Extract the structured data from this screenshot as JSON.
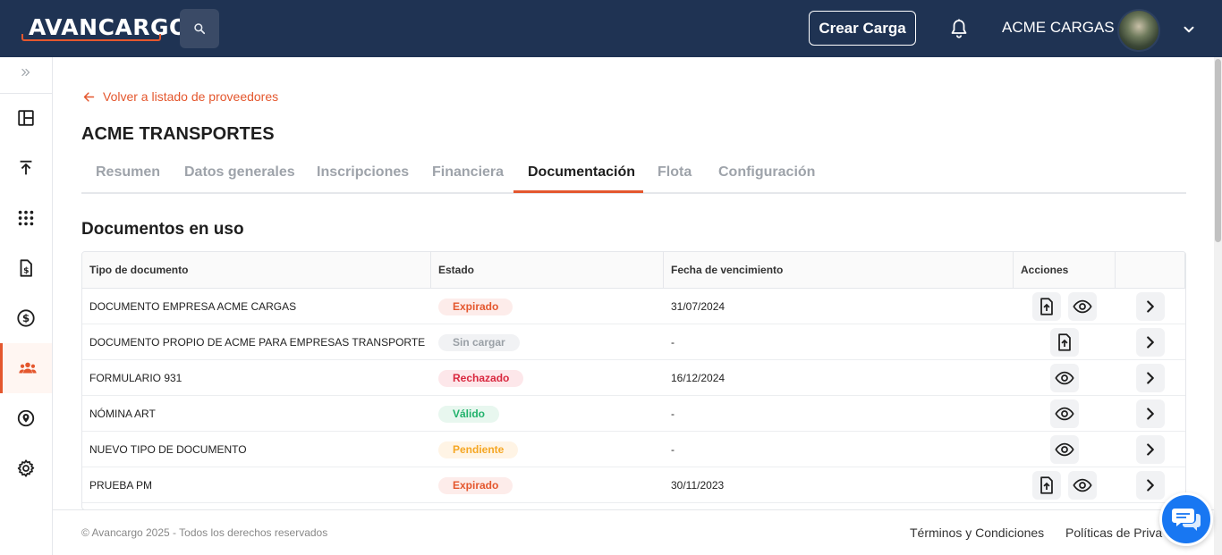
{
  "header": {
    "logo_text": "AVANCARGO",
    "create_button": "Crear Carga",
    "company_name": "ACME CARGAS"
  },
  "colors": {
    "topbar": "#1f3353",
    "accent": "#e4572e",
    "chat": "#1877f2"
  },
  "sidebar": {
    "items": [
      {
        "icon": "dashboard-icon"
      },
      {
        "icon": "upload-icon"
      },
      {
        "icon": "apps-grid-icon"
      },
      {
        "icon": "invoice-icon"
      },
      {
        "icon": "dollar-icon"
      },
      {
        "icon": "users-icon",
        "active": true
      },
      {
        "icon": "location-icon"
      },
      {
        "icon": "settings-icon"
      }
    ]
  },
  "main": {
    "back_link": "Volver a listado de proveedores",
    "title": "ACME TRANSPORTES",
    "tabs": [
      {
        "label": "Resumen"
      },
      {
        "label": "Datos generales"
      },
      {
        "label": "Inscripciones"
      },
      {
        "label": "Financiera"
      },
      {
        "label": "Documentación",
        "active": true
      },
      {
        "label": "Flota"
      },
      {
        "label": "Configuración"
      }
    ],
    "section_title": "Documentos en uso"
  },
  "table": {
    "headers": [
      "Tipo de documento",
      "Estado",
      "Fecha de vencimiento",
      "Acciones"
    ],
    "rows": [
      {
        "tipo": "DOCUMENTO EMPRESA ACME CARGAS",
        "estado": "Expirado",
        "fecha": "31/07/2024",
        "actions": [
          "upload",
          "view"
        ]
      },
      {
        "tipo": "DOCUMENTO PROPIO DE ACME PARA EMPRESAS TRANSPORTE",
        "estado": "Sin cargar",
        "fecha": "-",
        "actions": [
          "upload"
        ]
      },
      {
        "tipo": "FORMULARIO 931",
        "estado": "Rechazado",
        "fecha": "16/12/2024",
        "actions": [
          "view"
        ]
      },
      {
        "tipo": "NÓMINA ART",
        "estado": "Válido",
        "fecha": "-",
        "actions": [
          "view"
        ]
      },
      {
        "tipo": "NUEVO TIPO DE DOCUMENTO",
        "estado": "Pendiente",
        "fecha": "-",
        "actions": [
          "view"
        ]
      },
      {
        "tipo": "PRUEBA PM",
        "estado": "Expirado",
        "fecha": "30/11/2023",
        "actions": [
          "upload",
          "view"
        ]
      }
    ]
  },
  "footer": {
    "copyright": "© Avancargo 2025 - Todos los derechos reservados",
    "terms": "Términos y Condiciones",
    "privacy": "Políticas de Priva"
  }
}
